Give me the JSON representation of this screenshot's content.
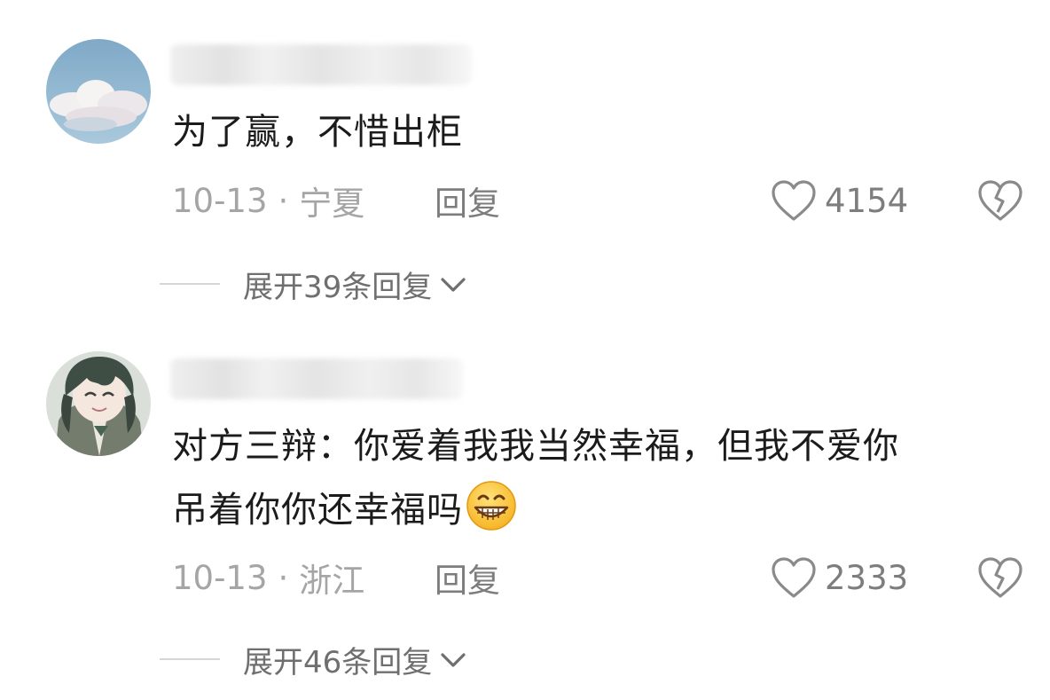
{
  "comments": [
    {
      "avatar": "sky-cloud-avatar",
      "text": "为了赢，不惜出柜",
      "text_line2": "",
      "date": "10-13",
      "separator": "·",
      "location": "宁夏",
      "reply_label": "回复",
      "likes": "4154",
      "expand_label": "展开39条回复"
    },
    {
      "avatar": "anime-character-avatar",
      "text": "对方三辩：你爱着我我当然幸福，但我不爱你",
      "text_line2": "吊着你你还幸福吗",
      "emoji": "grinning-face-emoji",
      "date": "10-13",
      "separator": "·",
      "location": "浙江",
      "reply_label": "回复",
      "likes": "2333",
      "expand_label": "展开46条回复"
    }
  ],
  "icons": {
    "like": "heart-icon",
    "dislike": "broken-heart-icon",
    "expand": "chevron-down-icon"
  }
}
